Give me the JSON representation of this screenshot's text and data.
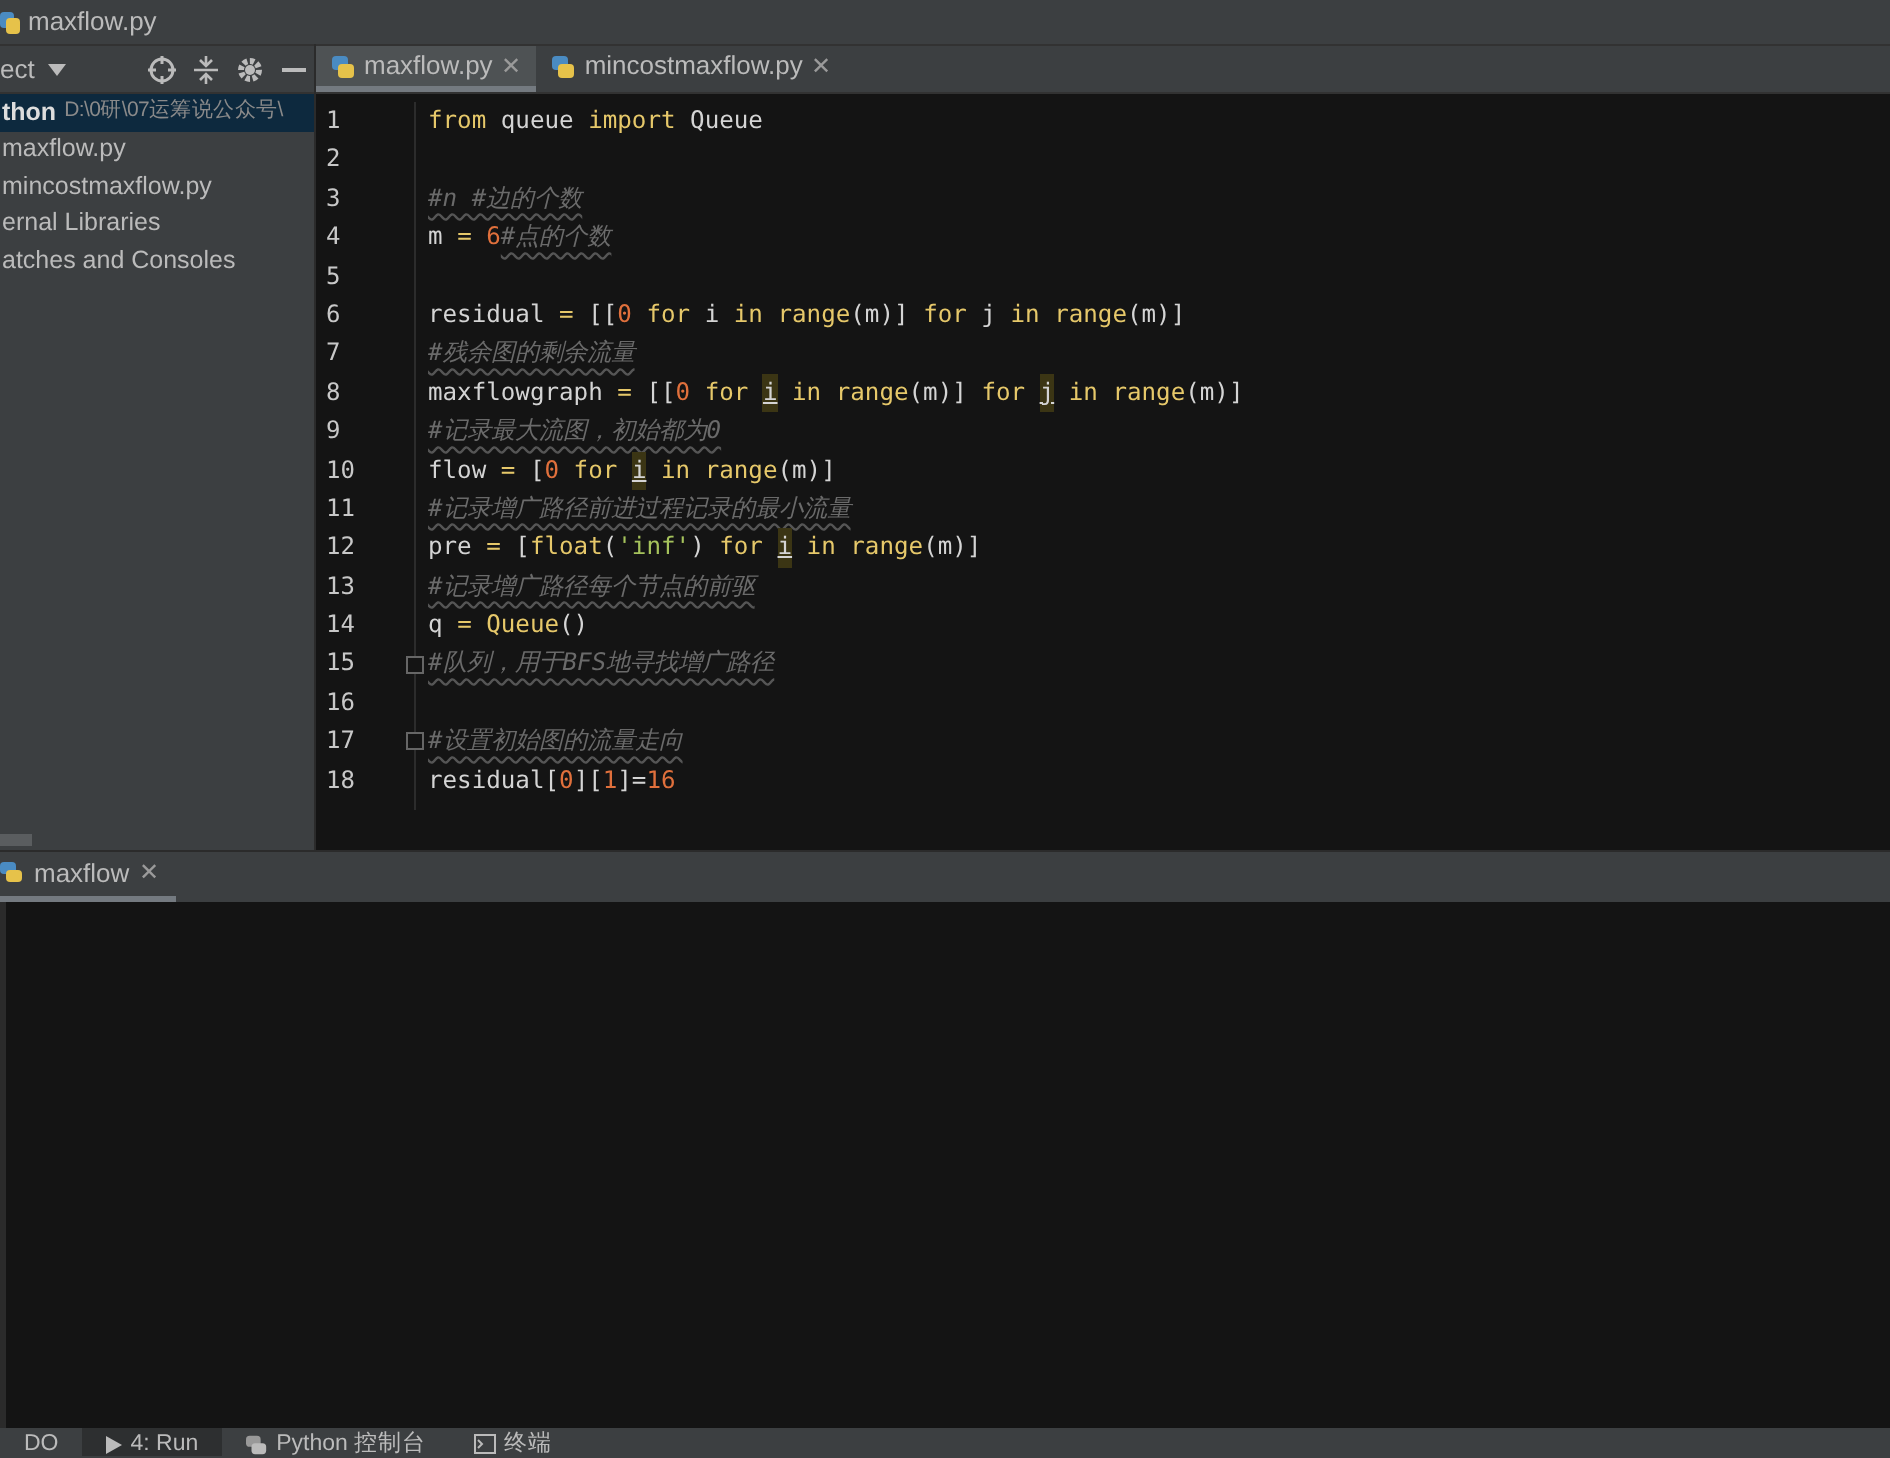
{
  "window": {
    "title": "maxflow.py"
  },
  "project_panel": {
    "title": "ect",
    "tree": [
      {
        "name": "thon",
        "path": "D:\\0研\\07运筹说公众号\\",
        "selected": true,
        "kind": "root"
      },
      {
        "name": "maxflow.py",
        "selected": false,
        "kind": "item"
      },
      {
        "name": "mincostmaxflow.py",
        "selected": false,
        "kind": "item"
      },
      {
        "name": "ernal Libraries",
        "selected": false,
        "kind": "item"
      },
      {
        "name": "atches and Consoles",
        "selected": false,
        "kind": "item"
      }
    ]
  },
  "editor_tabs": [
    {
      "label": "maxflow.py",
      "close": "✕",
      "selected": true
    },
    {
      "label": "mincostmaxflow.py",
      "close": "✕",
      "selected": false
    }
  ],
  "code_lines": [
    {
      "number": "1",
      "fold": false,
      "tokens": [
        {
          "kind": "kw",
          "text": "from"
        },
        {
          "kind": "id",
          "text": " queue "
        },
        {
          "kind": "kw",
          "text": "import"
        },
        {
          "kind": "id",
          "text": " Queue"
        }
      ]
    },
    {
      "number": "2",
      "fold": false
    },
    {
      "number": "3",
      "fold": false,
      "tokens": [
        {
          "kind": "cm",
          "text": "#n #边的个数"
        }
      ]
    },
    {
      "number": "4",
      "fold": false,
      "tokens": [
        {
          "kind": "id",
          "text": "m "
        },
        {
          "kind": "kw",
          "text": "="
        },
        {
          "kind": "num",
          "text": " 6"
        },
        {
          "kind": "cm",
          "text": "#点的个数"
        }
      ]
    },
    {
      "number": "5",
      "fold": false
    },
    {
      "number": "6",
      "fold": false,
      "tokens": [
        {
          "kind": "id",
          "text": "residual "
        },
        {
          "kind": "kw",
          "text": "="
        },
        {
          "kind": "id",
          "text": " [["
        },
        {
          "kind": "num",
          "text": "0"
        },
        {
          "kind": "kw",
          "text": " for"
        },
        {
          "kind": "id",
          "text": " i "
        },
        {
          "kind": "kw",
          "text": "in range"
        },
        {
          "kind": "id",
          "text": "(m)] "
        },
        {
          "kind": "kw",
          "text": "for"
        },
        {
          "kind": "id",
          "text": " j "
        },
        {
          "kind": "kw",
          "text": "in range"
        },
        {
          "kind": "id",
          "text": "(m)]"
        }
      ]
    },
    {
      "number": "7",
      "fold": false,
      "tokens": [
        {
          "kind": "cm",
          "text": "#残余图的剩余流量"
        }
      ]
    },
    {
      "number": "8",
      "fold": false,
      "tokens": [
        {
          "kind": "id",
          "text": "maxflowgraph "
        },
        {
          "kind": "kw",
          "text": "="
        },
        {
          "kind": "id",
          "text": " [["
        },
        {
          "kind": "num",
          "text": "0"
        },
        {
          "kind": "kw",
          "text": " for "
        },
        {
          "kind": "hl",
          "text": "i"
        },
        {
          "kind": "kw",
          "text": " in range"
        },
        {
          "kind": "id",
          "text": "(m)] "
        },
        {
          "kind": "kw",
          "text": "for "
        },
        {
          "kind": "hl",
          "text": "j"
        },
        {
          "kind": "kw",
          "text": " in range"
        },
        {
          "kind": "id",
          "text": "(m)]"
        }
      ]
    },
    {
      "number": "9",
      "fold": false,
      "tokens": [
        {
          "kind": "cm",
          "text": "#记录最大流图，初始都为0"
        }
      ]
    },
    {
      "number": "10",
      "fold": false,
      "tokens": [
        {
          "kind": "id",
          "text": "flow "
        },
        {
          "kind": "kw",
          "text": "="
        },
        {
          "kind": "id",
          "text": " ["
        },
        {
          "kind": "num",
          "text": "0"
        },
        {
          "kind": "kw",
          "text": " for "
        },
        {
          "kind": "hl",
          "text": "i"
        },
        {
          "kind": "kw",
          "text": " in range"
        },
        {
          "kind": "id",
          "text": "(m)]"
        }
      ]
    },
    {
      "number": "11",
      "fold": false,
      "tokens": [
        {
          "kind": "cm",
          "text": "#记录增广路径前进过程记录的最小流量"
        }
      ]
    },
    {
      "number": "12",
      "fold": false,
      "tokens": [
        {
          "kind": "id",
          "text": "pre "
        },
        {
          "kind": "kw",
          "text": "="
        },
        {
          "kind": "id",
          "text": " ["
        },
        {
          "kind": "kw",
          "text": "float"
        },
        {
          "kind": "id",
          "text": "("
        },
        {
          "kind": "str",
          "text": "'inf'"
        },
        {
          "kind": "id",
          "text": ") "
        },
        {
          "kind": "kw",
          "text": "for "
        },
        {
          "kind": "hl",
          "text": "i"
        },
        {
          "kind": "kw",
          "text": " in range"
        },
        {
          "kind": "id",
          "text": "(m)]"
        }
      ]
    },
    {
      "number": "13",
      "fold": false,
      "tokens": [
        {
          "kind": "cm",
          "text": "#记录增广路径每个节点的前驱"
        }
      ]
    },
    {
      "number": "14",
      "fold": false,
      "tokens": [
        {
          "kind": "id",
          "text": "q "
        },
        {
          "kind": "kw",
          "text": "= Queue"
        },
        {
          "kind": "id",
          "text": "()"
        }
      ]
    },
    {
      "number": "15",
      "fold": true,
      "tokens": [
        {
          "kind": "cm",
          "text": "#队列，用于BFS地寻找增广路径"
        }
      ]
    },
    {
      "number": "16",
      "fold": false
    },
    {
      "number": "17",
      "fold": true,
      "tokens": [
        {
          "kind": "cm",
          "text": "#设置初始图的流量走向"
        }
      ]
    },
    {
      "number": "18",
      "fold": false,
      "tokens": [
        {
          "kind": "id",
          "text": "residual["
        },
        {
          "kind": "num",
          "text": "0"
        },
        {
          "kind": "id",
          "text": "]["
        },
        {
          "kind": "num",
          "text": "1"
        },
        {
          "kind": "id",
          "text": "]="
        },
        {
          "kind": "num",
          "text": "16"
        }
      ]
    }
  ],
  "run_panel": {
    "tab": "maxflow",
    "close": "✕"
  },
  "bottom_tabs": [
    {
      "label": "DO",
      "selected": false
    },
    {
      "label": "4: Run",
      "kind": "run",
      "selected": true
    },
    {
      "label": "Python 控制台",
      "kind": "python",
      "selected": false
    },
    {
      "label": "终端",
      "kind": "terminal",
      "selected": false
    }
  ]
}
